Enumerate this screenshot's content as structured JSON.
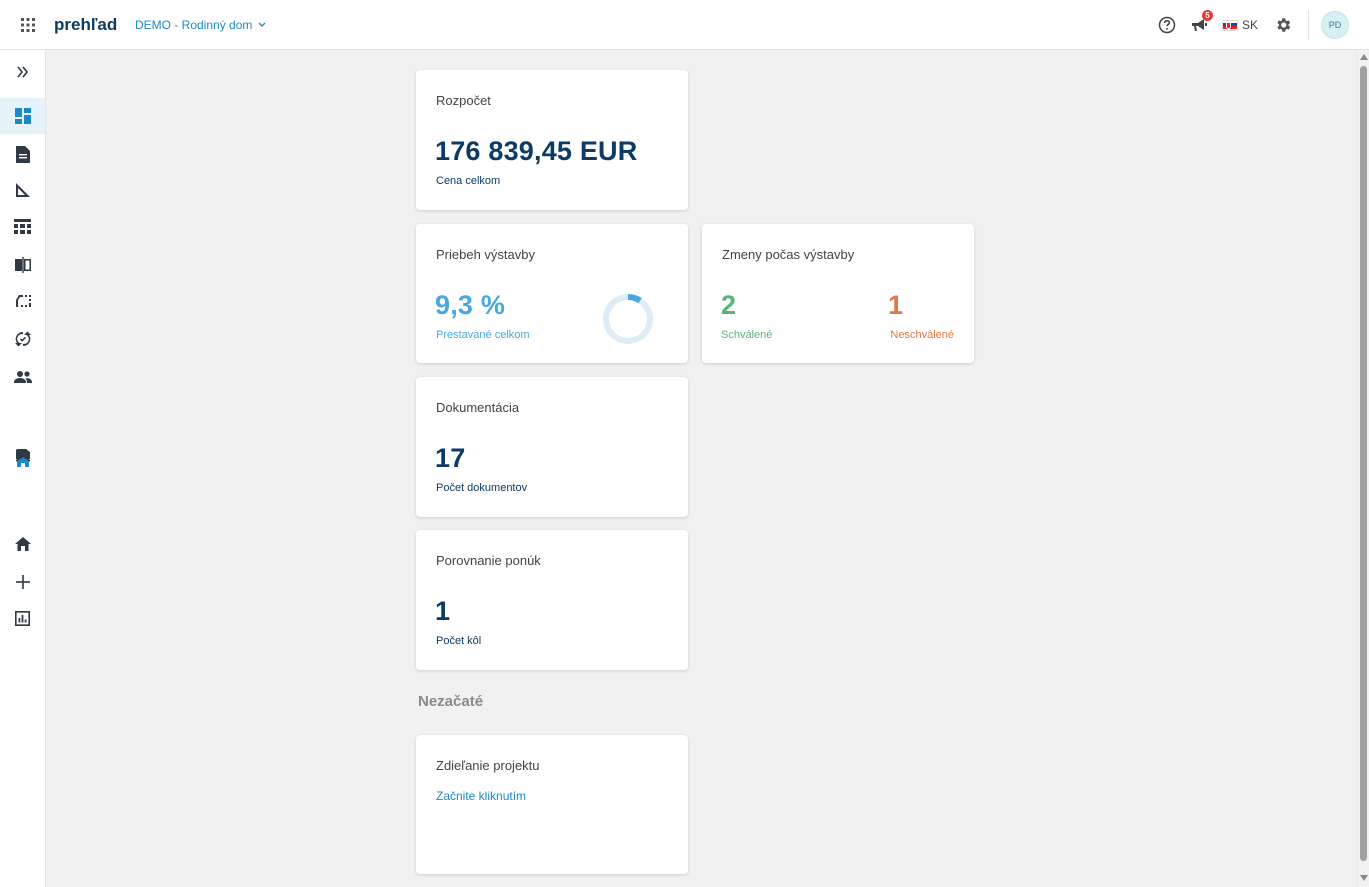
{
  "header": {
    "brand": "prehľad",
    "project": "DEMO - Rodinný dom",
    "notification_count": "5",
    "language": "SK",
    "user_initials": "PD"
  },
  "sidebar": {
    "items": [
      {
        "icon": "chevrons-right-icon",
        "active": false
      },
      {
        "icon": "dashboard-icon",
        "active": true
      },
      {
        "icon": "document-icon",
        "active": false
      },
      {
        "icon": "triangle-ruler-icon",
        "active": false
      },
      {
        "icon": "table-icon",
        "active": false
      },
      {
        "icon": "compare-icon",
        "active": false
      },
      {
        "icon": "crop-icon",
        "active": false
      },
      {
        "icon": "sync-icon",
        "active": false
      },
      {
        "icon": "people-icon",
        "active": false
      },
      {
        "icon": "building-icon",
        "active": false
      },
      {
        "icon": "home-icon",
        "active": false
      },
      {
        "icon": "plus-icon",
        "active": false
      },
      {
        "icon": "report-icon",
        "active": false
      }
    ]
  },
  "cards": {
    "budget": {
      "title": "Rozpočet",
      "value": "176 839,45 EUR",
      "label": "Cena celkom"
    },
    "progress": {
      "title": "Priebeh výstavby",
      "value": "9,3 %",
      "label": "Prestavané celkom",
      "percent": 9.3
    },
    "changes": {
      "title": "Zmeny počas výstavby",
      "approved_value": "2",
      "approved_label": "Schválené",
      "rejected_value": "1",
      "rejected_label": "Neschválené"
    },
    "documentation": {
      "title": "Dokumentácia",
      "value": "17",
      "label": "Počet dokumentov"
    },
    "offers": {
      "title": "Porovnanie ponúk",
      "value": "1",
      "label": "Počet kôl"
    }
  },
  "not_started": {
    "title": "Nezačaté",
    "sharing": {
      "title": "Zdieľanie projektu",
      "link": "Začnite kliknutím"
    }
  },
  "colors": {
    "primary": "#0e3a66",
    "accent": "#1e88c8",
    "progress": "#4aa8de",
    "approved": "#5cb37a",
    "rejected": "#e07848"
  }
}
